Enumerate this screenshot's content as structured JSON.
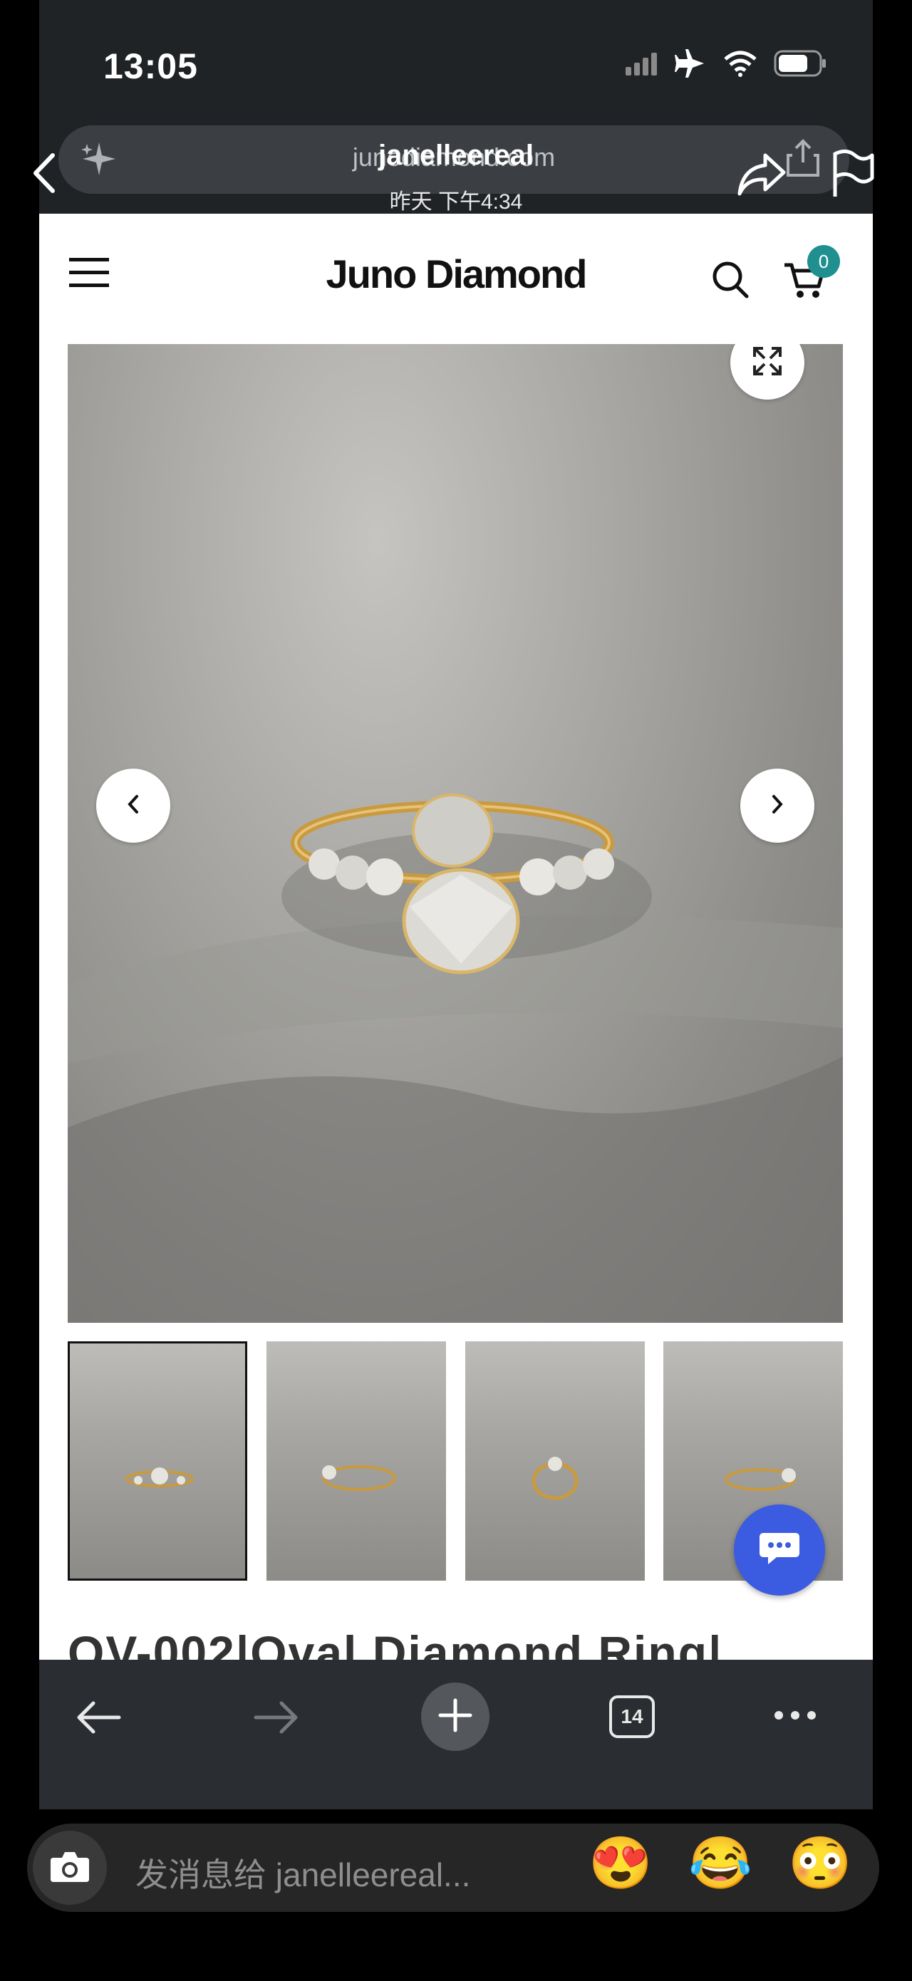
{
  "status_bar": {
    "time": "13:05"
  },
  "story": {
    "username": "janelleereal",
    "timestamp": "昨天 下午4:34"
  },
  "browser": {
    "url": "junodiamond.com",
    "tab_count": "14"
  },
  "site": {
    "logo": "Juno Diamond",
    "cart_count": "0",
    "product_title_partial": "OV-002|Oval Diamond Ring|..."
  },
  "reply": {
    "placeholder": "发消息给 janelleereal...",
    "quick_reactions": [
      "😍",
      "😂",
      "😳"
    ]
  },
  "colors": {
    "cart_badge": "#1f8f8f",
    "chat_fab": "#3b5be0",
    "browser_chrome": "#202326"
  },
  "icons": [
    "back-chevron-icon",
    "sparkle-icon",
    "share-arrow-icon",
    "upload-icon",
    "flag-icon",
    "hamburger-icon",
    "search-icon",
    "cart-icon",
    "expand-icon",
    "chevron-left-icon",
    "chevron-right-icon",
    "chat-icon",
    "arrow-left-icon",
    "arrow-right-icon",
    "plus-icon",
    "tabs-icon",
    "more-icon",
    "camera-icon"
  ]
}
